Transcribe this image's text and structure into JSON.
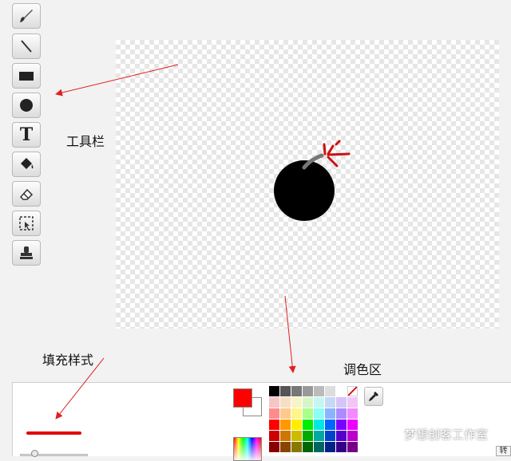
{
  "annotations": {
    "toolbar": "工具栏",
    "fill_style": "填充样式",
    "palette": "调色区"
  },
  "tools": [
    {
      "name": "brush-icon"
    },
    {
      "name": "line-icon"
    },
    {
      "name": "rectangle-icon"
    },
    {
      "name": "ellipse-icon"
    },
    {
      "name": "text-icon",
      "glyph": "T"
    },
    {
      "name": "fill-bucket-icon"
    },
    {
      "name": "eraser-icon"
    },
    {
      "name": "select-icon"
    },
    {
      "name": "stamp-icon"
    }
  ],
  "colors": {
    "foreground": "#ff0000",
    "background": "#ffffff",
    "annotation_arrow": "#e02020",
    "fill_style_line": "#e00000"
  },
  "palette": [
    "#000000",
    "#555555",
    "#777777",
    "#999999",
    "#bbbbbb",
    "#dddddd",
    "#ffffff",
    "none",
    "#f7c5c5",
    "#f7dfc5",
    "#f7f5c5",
    "#d5f7c5",
    "#c5f7f2",
    "#c5d9f7",
    "#d5c5f7",
    "#f2c5f7",
    "#ff8b8b",
    "#ffc98b",
    "#fff58b",
    "#abff8b",
    "#8bfff2",
    "#8bb3ff",
    "#ab8bff",
    "#f28bff",
    "#ff0000",
    "#ff9900",
    "#ffee00",
    "#00ee00",
    "#00e8e0",
    "#0066ff",
    "#7a00ff",
    "#ee00ff",
    "#cc0000",
    "#cc7700",
    "#ccbb00",
    "#00aa00",
    "#00aaa0",
    "#0044cc",
    "#5500cc",
    "#bb00cc",
    "#880000",
    "#884400",
    "#887700",
    "#006600",
    "#006660",
    "#002288",
    "#330088",
    "#770088"
  ],
  "watermark": "梦想创客工作室",
  "corner_label": "转"
}
